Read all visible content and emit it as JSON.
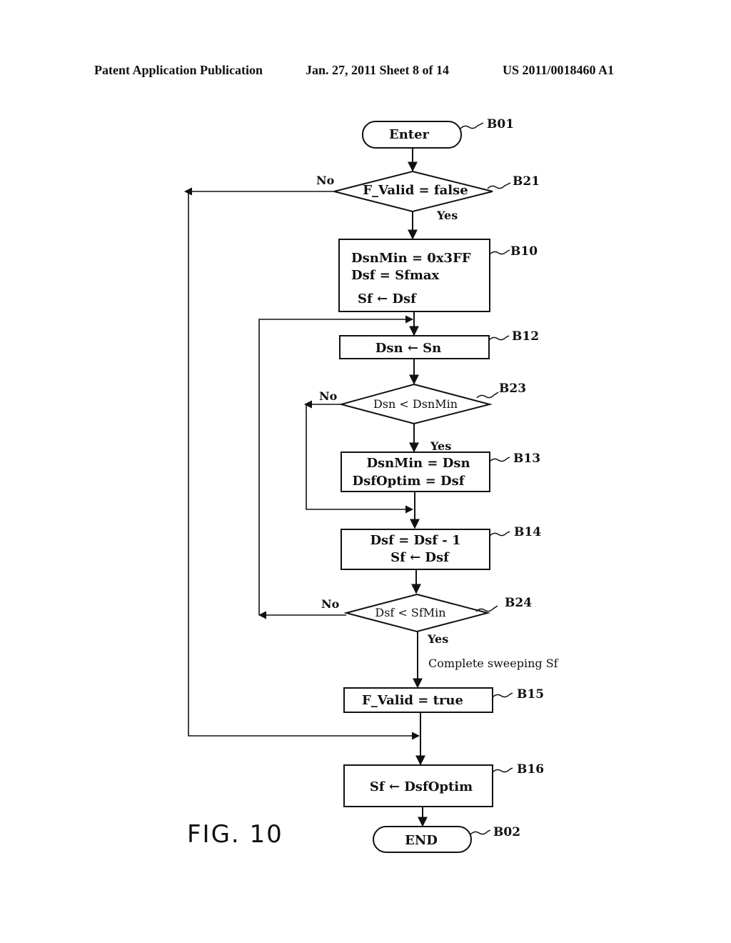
{
  "header": {
    "left": "Patent Application Publication",
    "middle": "Jan. 27, 2011  Sheet 8 of 14",
    "right": "US 2011/0018460 A1"
  },
  "figure_label": "FIG. 10",
  "flowchart": {
    "nodes": {
      "B01": {
        "ref": "B01",
        "type": "terminal",
        "lines": [
          "Enter"
        ]
      },
      "B21": {
        "ref": "B21",
        "type": "decision",
        "lines": [
          "F_Valid = false"
        ],
        "yes": "Yes",
        "no": "No"
      },
      "B10": {
        "ref": "B10",
        "type": "process",
        "lines": [
          "DsnMin = 0x3FF",
          "Dsf = Sfmax",
          "Sf ← Dsf"
        ]
      },
      "B12": {
        "ref": "B12",
        "type": "process",
        "lines": [
          "Dsn ← Sn"
        ]
      },
      "B23": {
        "ref": "B23",
        "type": "decision",
        "lines": [
          "Dsn < DsnMin"
        ],
        "yes": "Yes",
        "no": "No"
      },
      "B13": {
        "ref": "B13",
        "type": "process",
        "lines": [
          "DsnMin = Dsn",
          "DsfOptim = Dsf"
        ]
      },
      "B14": {
        "ref": "B14",
        "type": "process",
        "lines": [
          "Dsf = Dsf - 1",
          "Sf ← Dsf"
        ]
      },
      "B24": {
        "ref": "B24",
        "type": "decision",
        "lines": [
          "Dsf < SfMin"
        ],
        "yes": "Yes",
        "no": "No"
      },
      "B15": {
        "ref": "B15",
        "type": "process",
        "lines": [
          "F_Valid = true"
        ]
      },
      "B16": {
        "ref": "B16",
        "type": "process",
        "lines": [
          "Sf ← DsfOptim"
        ]
      },
      "B02": {
        "ref": "B02",
        "type": "terminal",
        "lines": [
          "END"
        ]
      }
    },
    "notes": {
      "sweep_complete": "Complete sweeping Sf"
    },
    "edges": [
      {
        "from": "B01",
        "to": "B21"
      },
      {
        "from": "B21",
        "to": "B10",
        "label": "Yes"
      },
      {
        "from": "B21",
        "to": "B16",
        "label": "No"
      },
      {
        "from": "B10",
        "to": "B12"
      },
      {
        "from": "B12",
        "to": "B23"
      },
      {
        "from": "B23",
        "to": "B13",
        "label": "Yes"
      },
      {
        "from": "B23",
        "to": "B14",
        "label": "No"
      },
      {
        "from": "B13",
        "to": "B14"
      },
      {
        "from": "B14",
        "to": "B24"
      },
      {
        "from": "B24",
        "to": "B12",
        "label": "No"
      },
      {
        "from": "B24",
        "to": "B15",
        "label": "Yes"
      },
      {
        "from": "B15",
        "to": "B16"
      },
      {
        "from": "B16",
        "to": "B02"
      }
    ]
  }
}
